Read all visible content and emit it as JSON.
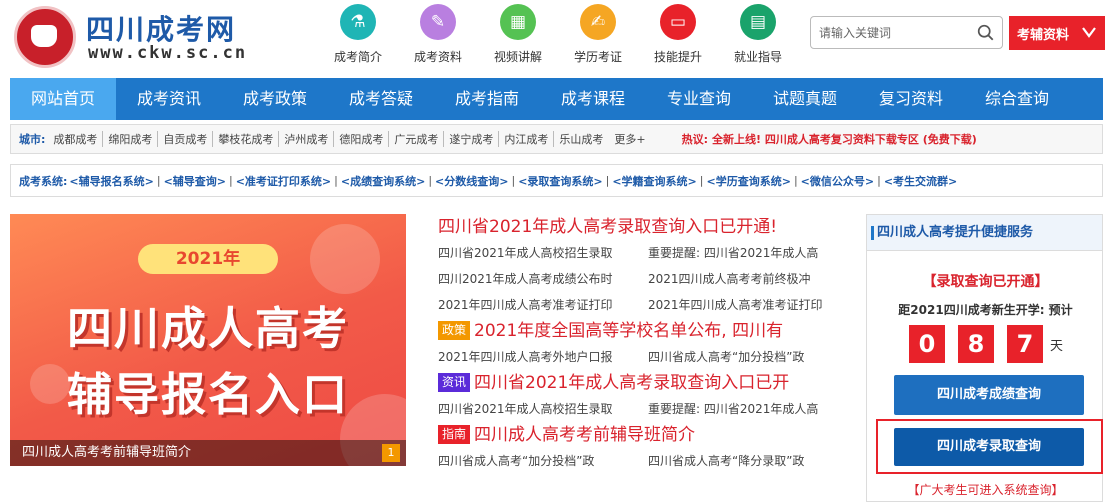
{
  "header": {
    "site_name": "四川成考网",
    "site_url": "www.ckw.sc.cn",
    "top_nav": [
      {
        "label": "成考简介",
        "icon": "flask-icon",
        "color": "#1fb5b5",
        "glyph": "⚗"
      },
      {
        "label": "成考资料",
        "icon": "book-icon",
        "color": "#b97fe0",
        "glyph": "✎"
      },
      {
        "label": "视频讲解",
        "icon": "building-icon",
        "color": "#55c253",
        "glyph": "▦"
      },
      {
        "label": "学历考证",
        "icon": "certificate-icon",
        "color": "#f5a623",
        "glyph": "✍"
      },
      {
        "label": "技能提升",
        "icon": "laptop-icon",
        "color": "#e8222a",
        "glyph": "▭"
      },
      {
        "label": "就业指导",
        "icon": "clipboard-icon",
        "color": "#1aa36b",
        "glyph": "▤"
      }
    ],
    "search_placeholder": "请输入关键词",
    "fudao_label": "考辅资料"
  },
  "main_nav": [
    "网站首页",
    "成考资讯",
    "成考政策",
    "成考答疑",
    "成考指南",
    "成考课程",
    "专业查询",
    "试题真题",
    "复习资料",
    "综合查询"
  ],
  "city_bar": {
    "label": "城市:",
    "cities": [
      "成都成考",
      "绵阳成考",
      "自贡成考",
      "攀枝花成考",
      "泸州成考",
      "德阳成考",
      "广元成考",
      "遂宁成考",
      "内江成考",
      "乐山成考"
    ],
    "more": "更多+",
    "hot_label": "热议:",
    "hot_text": "全新上线! 四川成人高考复习资料下载专区 (免费下载)"
  },
  "system_bar": {
    "label": "成考系统:",
    "items": [
      "<辅导报名系统>",
      "<辅导查询>",
      "<准考证打印系统>",
      "<成绩查询系统>",
      "<分数线查询>",
      "<录取查询系统>",
      "<学籍查询系统>",
      "<学历查询系统>",
      "<微信公众号>",
      "<考生交流群>"
    ],
    "separator": "|"
  },
  "banner": {
    "year": "2021年",
    "line1": "四川成人高考",
    "line2": "辅导报名入口",
    "caption": "四川成人高考考前辅导班简介",
    "page_number": "1"
  },
  "news": {
    "blocks": [
      {
        "tag": "",
        "tag_color": "",
        "headline": "四川省2021年成人高考录取查询入口已开通!",
        "rows": [
          [
            "四川省2021年成人高校招生录取",
            "重要提醒: 四川省2021年成人高"
          ],
          [
            "四川2021年成人高考成绩公布时",
            "2021四川成人高考考前终极冲"
          ],
          [
            "2021年四川成人高考准考证打印",
            "2021年四川成人高考准考证打印"
          ]
        ]
      },
      {
        "tag": "政策",
        "tag_color": "#f39800",
        "headline": "2021年度全国高等学校名单公布, 四川有",
        "rows": [
          [
            "2021年四川成人高考外地户口报",
            "四川省成人高考“加分投档”政"
          ]
        ]
      },
      {
        "tag": "资讯",
        "tag_color": "#5b2bd9",
        "headline": "四川省2021年成人高考录取查询入口已开",
        "rows": [
          [
            "四川省2021年成人高校招生录取",
            "重要提醒: 四川省2021年成人高"
          ]
        ]
      },
      {
        "tag": "指南",
        "tag_color": "#e8222a",
        "headline": "四川成人高考考前辅导班简介",
        "rows": [
          [
            "四川省成人高考“加分投档”政",
            "四川省成人高考“降分录取”政"
          ]
        ]
      }
    ]
  },
  "panel": {
    "title": "四川成人高考提升便捷服务",
    "open_text": "【录取查询已开通】",
    "countdown_label": "距2021四川成考新生开学: 预计",
    "digits": [
      "0",
      "8",
      "7"
    ],
    "day_unit": "天",
    "score_button": "四川成考成绩查询",
    "admit_button": "四川成考录取查询",
    "bottom_note": "【广大考生可进入系统查询】"
  }
}
